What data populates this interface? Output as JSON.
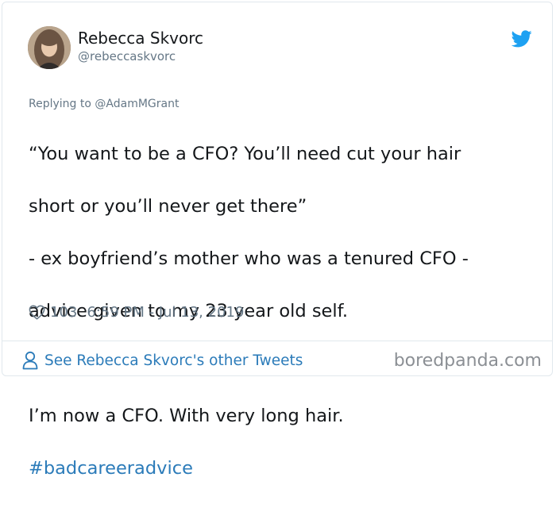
{
  "author": {
    "name": "Rebecca Skvorc",
    "handle": "@rebeccaskvorc",
    "avatar_icon": "user-avatar-photo"
  },
  "brand_icon": "twitter-bird-icon",
  "reply": {
    "prefix": "Replying to ",
    "mention": "@AdamMGrant"
  },
  "tweet": {
    "lines": [
      "“You want to be a CFO? You’ll need cut your hair",
      "short or you’ll never get there”",
      "- ex boyfriend’s mother who was a tenured CFO -",
      "advice given to my 23 year old self.",
      "",
      "I’m now a CFO. With very long hair."
    ],
    "hashtag": "#badcareeradvice"
  },
  "meta": {
    "likes": "103",
    "timestamp": "6:59 PM - Jul 13, 2019"
  },
  "footer": {
    "link": "See Rebecca Skvorc's other Tweets",
    "watermark": "boredpanda.com"
  },
  "colors": {
    "link": "#2b7bb9",
    "twitter_blue": "#1da1f2",
    "muted": "#657786",
    "text": "#14171a"
  }
}
